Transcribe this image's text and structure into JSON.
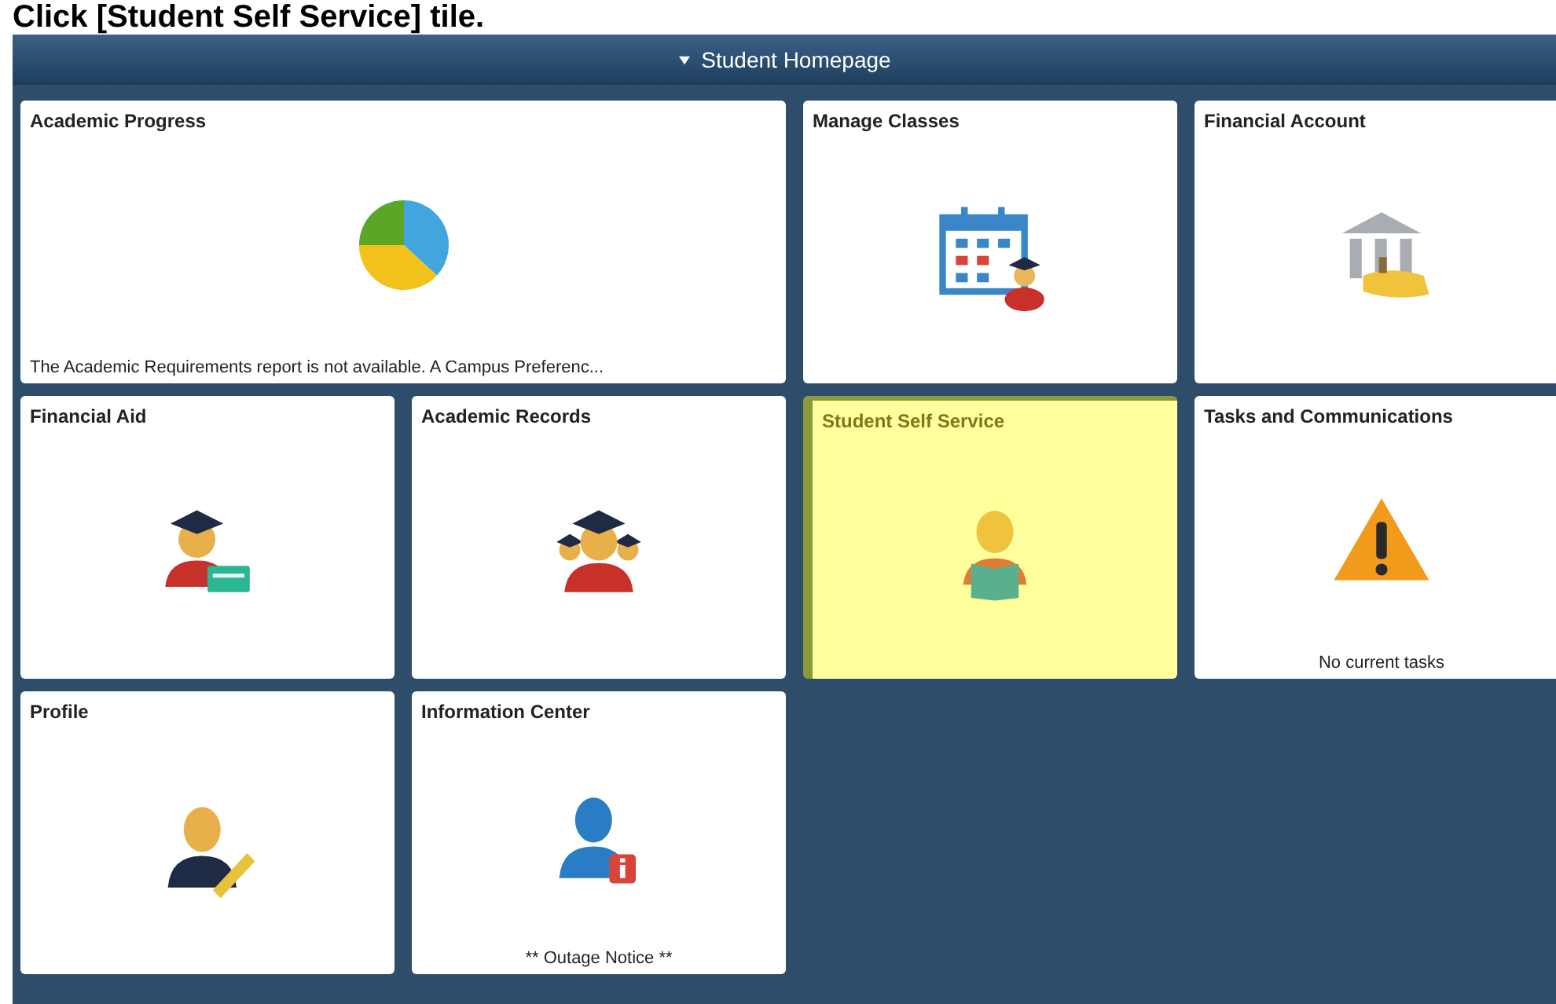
{
  "instruction": "Click [Student Self Service] tile.",
  "banner": {
    "title": "Student Homepage"
  },
  "tiles": [
    {
      "title": "Academic Progress",
      "selected": false,
      "note": "The Academic Requirements report is not available.  A Campus Preferenc..."
    },
    {
      "title": "Manage Classes",
      "selected": false
    },
    {
      "title": "Financial Account",
      "selected": false
    },
    {
      "title": "Financial Aid",
      "selected": false
    },
    {
      "title": "Academic Records",
      "selected": false
    },
    {
      "title": "Student Self Service",
      "selected": true
    },
    {
      "title": "Tasks and Communications",
      "selected": false,
      "note": "No current tasks"
    },
    {
      "title": "Profile",
      "selected": false
    },
    {
      "title": "Information Center",
      "selected": false,
      "note": "** Outage Notice **"
    }
  ]
}
